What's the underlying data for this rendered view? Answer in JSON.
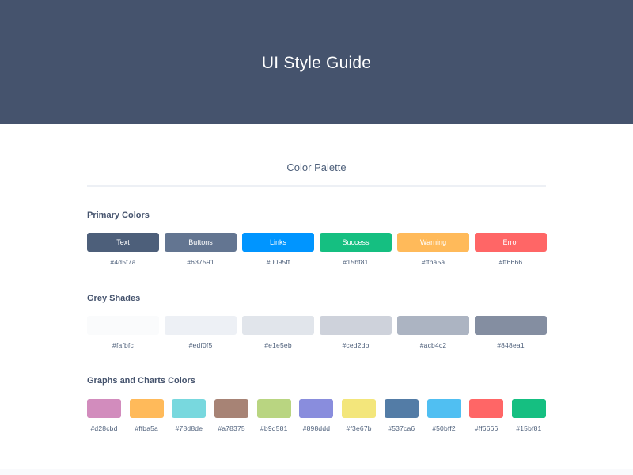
{
  "header": {
    "title": "UI Style Guide"
  },
  "palette": {
    "heading": "Color Palette",
    "primary": {
      "title": "Primary Colors",
      "swatches": [
        {
          "label": "Text",
          "hex": "#4d5f7a",
          "color": "#4d5f7a"
        },
        {
          "label": "Buttons",
          "hex": "#637591",
          "color": "#637591"
        },
        {
          "label": "Links",
          "hex": "#0095ff",
          "color": "#0095ff"
        },
        {
          "label": "Success",
          "hex": "#15bf81",
          "color": "#15bf81"
        },
        {
          "label": "Warning",
          "hex": "#ffba5a",
          "color": "#ffba5a"
        },
        {
          "label": "Error",
          "hex": "#ff6666",
          "color": "#ff6666"
        }
      ]
    },
    "grey": {
      "title": "Grey Shades",
      "swatches": [
        {
          "hex": "#fafbfc",
          "color": "#fafbfc"
        },
        {
          "hex": "#edf0f5",
          "color": "#edf0f5"
        },
        {
          "hex": "#e1e5eb",
          "color": "#e1e5eb"
        },
        {
          "hex": "#ced2db",
          "color": "#ced2db"
        },
        {
          "hex": "#acb4c2",
          "color": "#acb4c2"
        },
        {
          "hex": "#848ea1",
          "color": "#848ea1"
        }
      ]
    },
    "charts": {
      "title": "Graphs and Charts Colors",
      "swatches": [
        {
          "hex": "#d28cbd",
          "color": "#d28cbd"
        },
        {
          "hex": "#ffba5a",
          "color": "#ffba5a"
        },
        {
          "hex": "#78d8de",
          "color": "#78d8de"
        },
        {
          "hex": "#a78375",
          "color": "#a78375"
        },
        {
          "hex": "#b9d581",
          "color": "#b9d581"
        },
        {
          "hex": "#898ddd",
          "color": "#898ddd"
        },
        {
          "hex": "#f3e67b",
          "color": "#f3e67b"
        },
        {
          "hex": "#537ca6",
          "color": "#537ca6"
        },
        {
          "hex": "#50bff2",
          "color": "#50bff2"
        },
        {
          "hex": "#ff6666",
          "color": "#ff6666"
        },
        {
          "hex": "#15bf81",
          "color": "#15bf81"
        }
      ]
    }
  }
}
